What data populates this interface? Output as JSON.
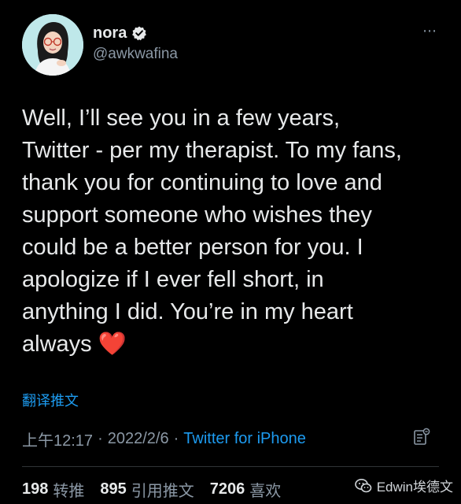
{
  "author": {
    "name": "nora",
    "handle": "@awkwafina"
  },
  "more_icon": "⋯",
  "tweet": {
    "text": "Well, I’ll see you in a few years,\nTwitter - per my therapist. To my fans,\nthank you for continuing to love and\nsupport someone who wishes they\ncould be a better person for you. I\napologize if I ever fell short, in\nanything I did. You’re in my heart\nalways ",
    "emoji": "❤️"
  },
  "translate_label": "翻译推文",
  "meta": {
    "time": "上午12:17",
    "sep1": "·",
    "date": "2022/2/6",
    "sep2": "·",
    "source": "Twitter for iPhone"
  },
  "stats": {
    "retweets_count": "198",
    "retweets_label": "转推",
    "quotes_count": "895",
    "quotes_label": "引用推文",
    "likes_count": "7206",
    "likes_label": "喜欢"
  },
  "watermark": {
    "text": "Edwin埃德文"
  },
  "colors": {
    "background": "#000000",
    "text": "#e7e9ea",
    "muted": "#8b98a5",
    "link": "#1d9bf0",
    "heart": "#e0245e"
  },
  "icons": {
    "verified": "verified-badge-icon",
    "analytics": "analytics-icon",
    "watermark": "wechat-icon"
  }
}
